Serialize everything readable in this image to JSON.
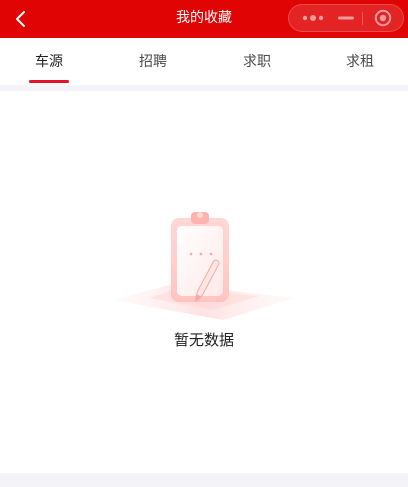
{
  "header": {
    "title": "我的收藏",
    "icons": {
      "back": "chevron-left-icon",
      "more": "more-dots-icon",
      "minimize": "minus-icon",
      "close": "target-circle-icon"
    },
    "colors": {
      "background": "#e10404",
      "text": "#ffffff"
    }
  },
  "tabs": [
    {
      "label": "车源",
      "active": true
    },
    {
      "label": "招聘",
      "active": false
    },
    {
      "label": "求职",
      "active": false
    },
    {
      "label": "求租",
      "active": false
    }
  ],
  "accent_color": "#e5102a",
  "empty_state": {
    "illustration": "clipboard-pen-icon",
    "message": "暂无数据"
  }
}
